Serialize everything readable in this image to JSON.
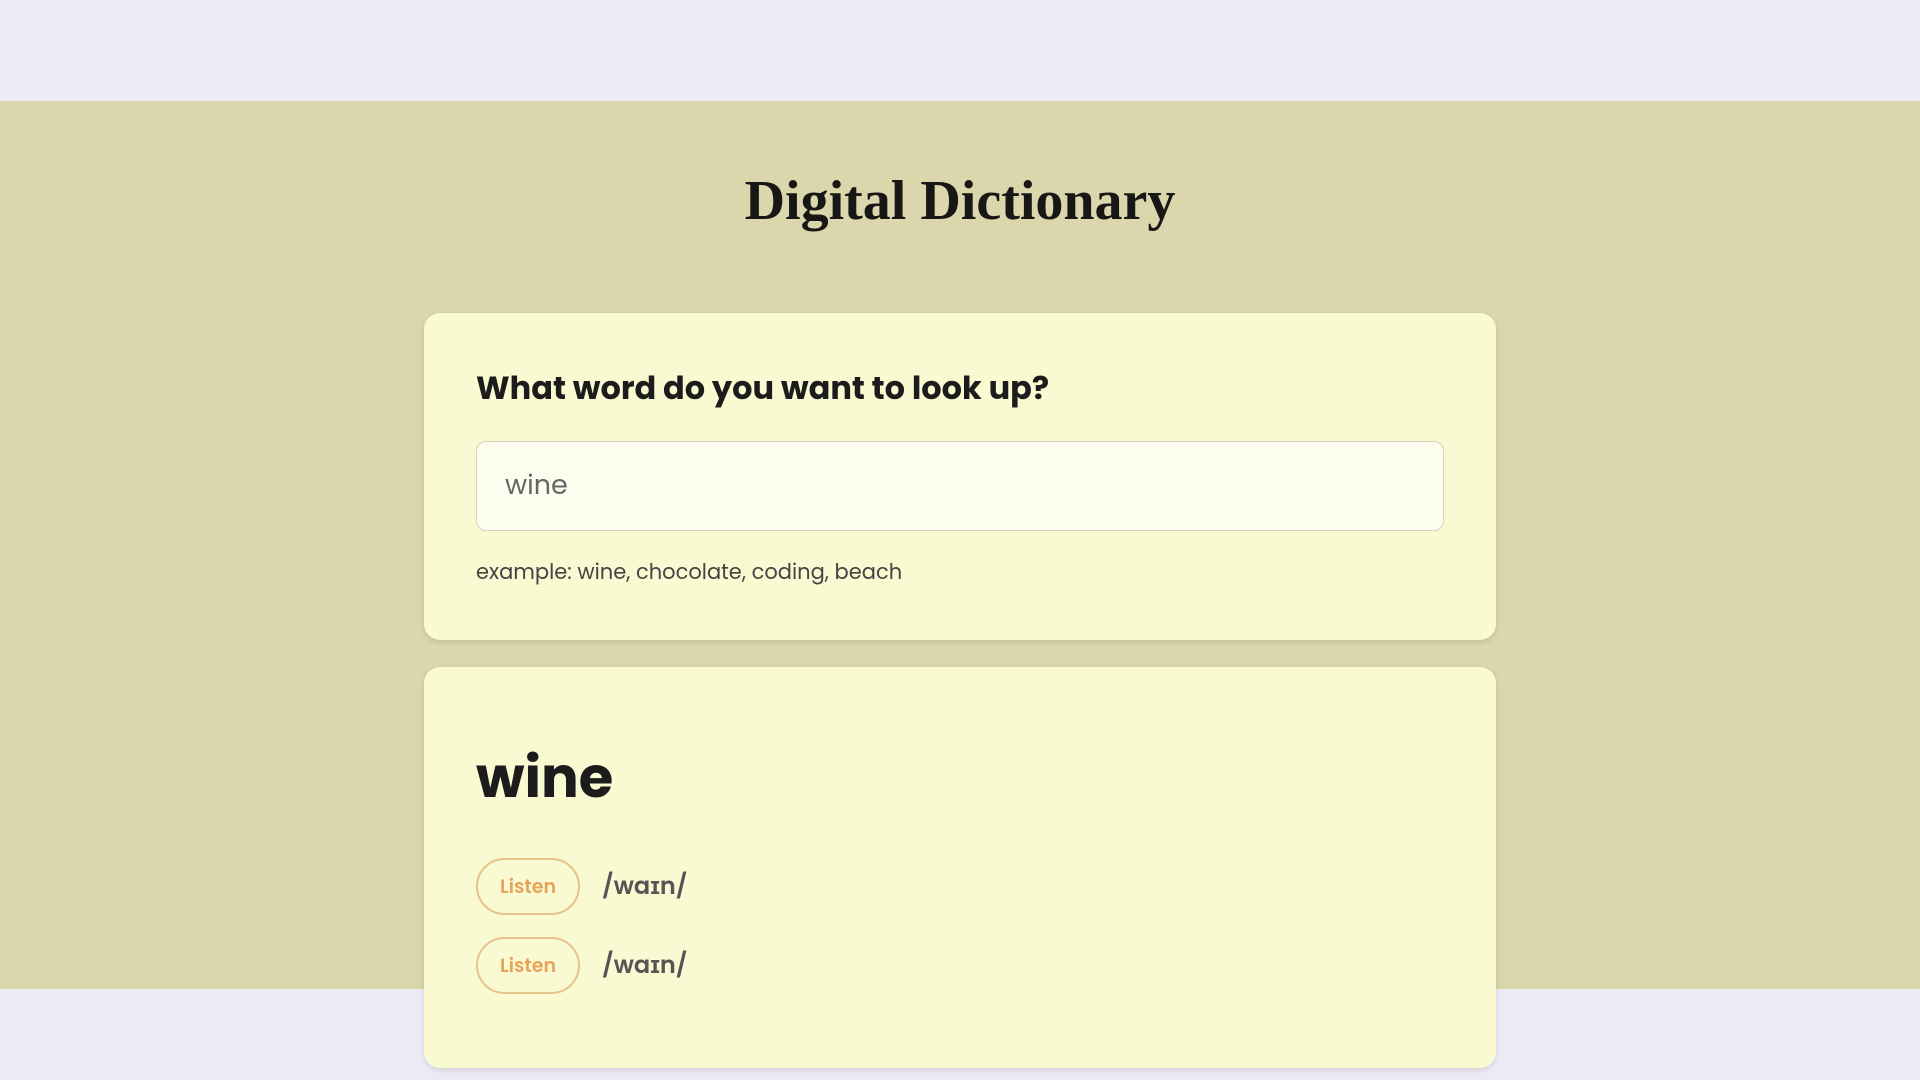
{
  "page_title": "Digital Dictionary",
  "search": {
    "prompt": "What word do you want to look up?",
    "value": "wine",
    "example": "example: wine, chocolate, coding, beach"
  },
  "result": {
    "word": "wine",
    "pronunciations": [
      {
        "button_label": "Listen",
        "ipa": "/waɪn/"
      },
      {
        "button_label": "Listen",
        "ipa": "/waɪn/"
      }
    ]
  }
}
